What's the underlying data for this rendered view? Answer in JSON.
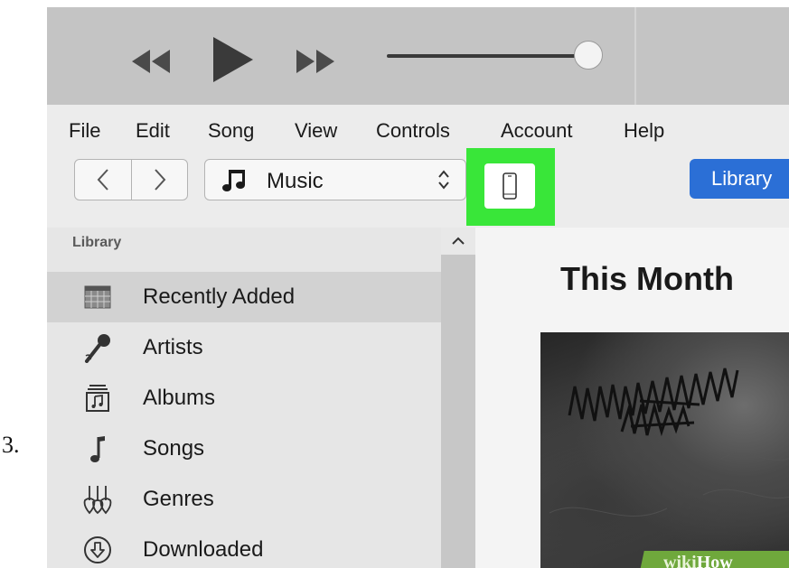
{
  "step": {
    "number": "3."
  },
  "player": {
    "rewind_icon": "rewind-icon",
    "play_icon": "play-icon",
    "fast_forward_icon": "fast-forward-icon",
    "volume_level": 1.0
  },
  "menu": {
    "items": [
      {
        "id": "file",
        "label": "File"
      },
      {
        "id": "edit",
        "label": "Edit"
      },
      {
        "id": "song",
        "label": "Song"
      },
      {
        "id": "view",
        "label": "View"
      },
      {
        "id": "controls",
        "label": "Controls"
      },
      {
        "id": "account",
        "label": "Account"
      },
      {
        "id": "help",
        "label": "Help"
      }
    ]
  },
  "toolbar": {
    "back_icon": "chevron-left-icon",
    "forward_icon": "chevron-right-icon",
    "media_kind": "Music",
    "media_icon": "music-note-icon",
    "device_icon": "iphone-icon",
    "device_highlight_color": "#39e639",
    "library_label": "Library",
    "accent_color": "#2b6fd6"
  },
  "sidebar": {
    "heading": "Library",
    "items": [
      {
        "label": "Recently Added",
        "icon": "calendar-grid-icon",
        "selected": true
      },
      {
        "label": "Artists",
        "icon": "microphone-icon",
        "selected": false
      },
      {
        "label": "Albums",
        "icon": "album-stack-icon",
        "selected": false
      },
      {
        "label": "Songs",
        "icon": "music-note-icon",
        "selected": false
      },
      {
        "label": "Genres",
        "icon": "guitar-icon",
        "selected": false
      },
      {
        "label": "Downloaded",
        "icon": "download-circle-icon",
        "selected": false
      }
    ]
  },
  "main": {
    "section_title": "This Month"
  },
  "watermark": {
    "part1": "wiki",
    "part2": "How"
  }
}
